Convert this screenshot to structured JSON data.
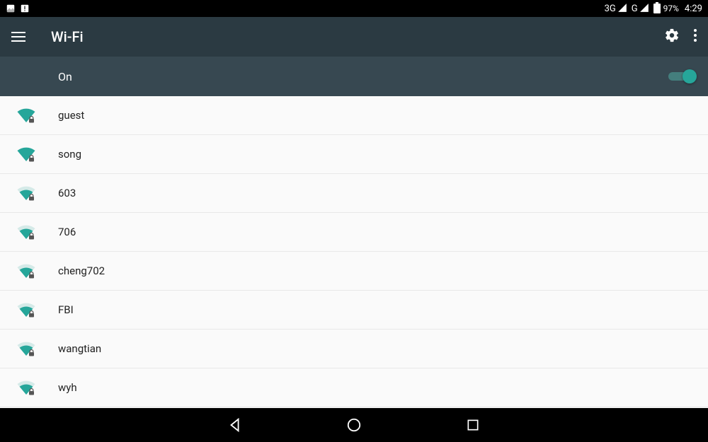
{
  "status": {
    "network_label_1": "3G",
    "network_label_2": "G",
    "battery_percent": "97%",
    "time": "4:29"
  },
  "app_bar": {
    "title": "Wi-Fi"
  },
  "toggle": {
    "label": "On",
    "on": true
  },
  "networks": [
    {
      "name": "guest",
      "strength": 4,
      "secured": true
    },
    {
      "name": "song",
      "strength": 4,
      "secured": true
    },
    {
      "name": "603",
      "strength": 3,
      "secured": true
    },
    {
      "name": "706",
      "strength": 3,
      "secured": true
    },
    {
      "name": "cheng702",
      "strength": 3,
      "secured": true
    },
    {
      "name": "FBI",
      "strength": 3,
      "secured": true
    },
    {
      "name": "wangtian",
      "strength": 3,
      "secured": true
    },
    {
      "name": "wyh",
      "strength": 3,
      "secured": true
    }
  ],
  "colors": {
    "accent": "#26a69a",
    "accent_dim": "#8fcac5",
    "app_bar_bg": "#2b3a42",
    "toggle_row_bg": "#374851"
  }
}
